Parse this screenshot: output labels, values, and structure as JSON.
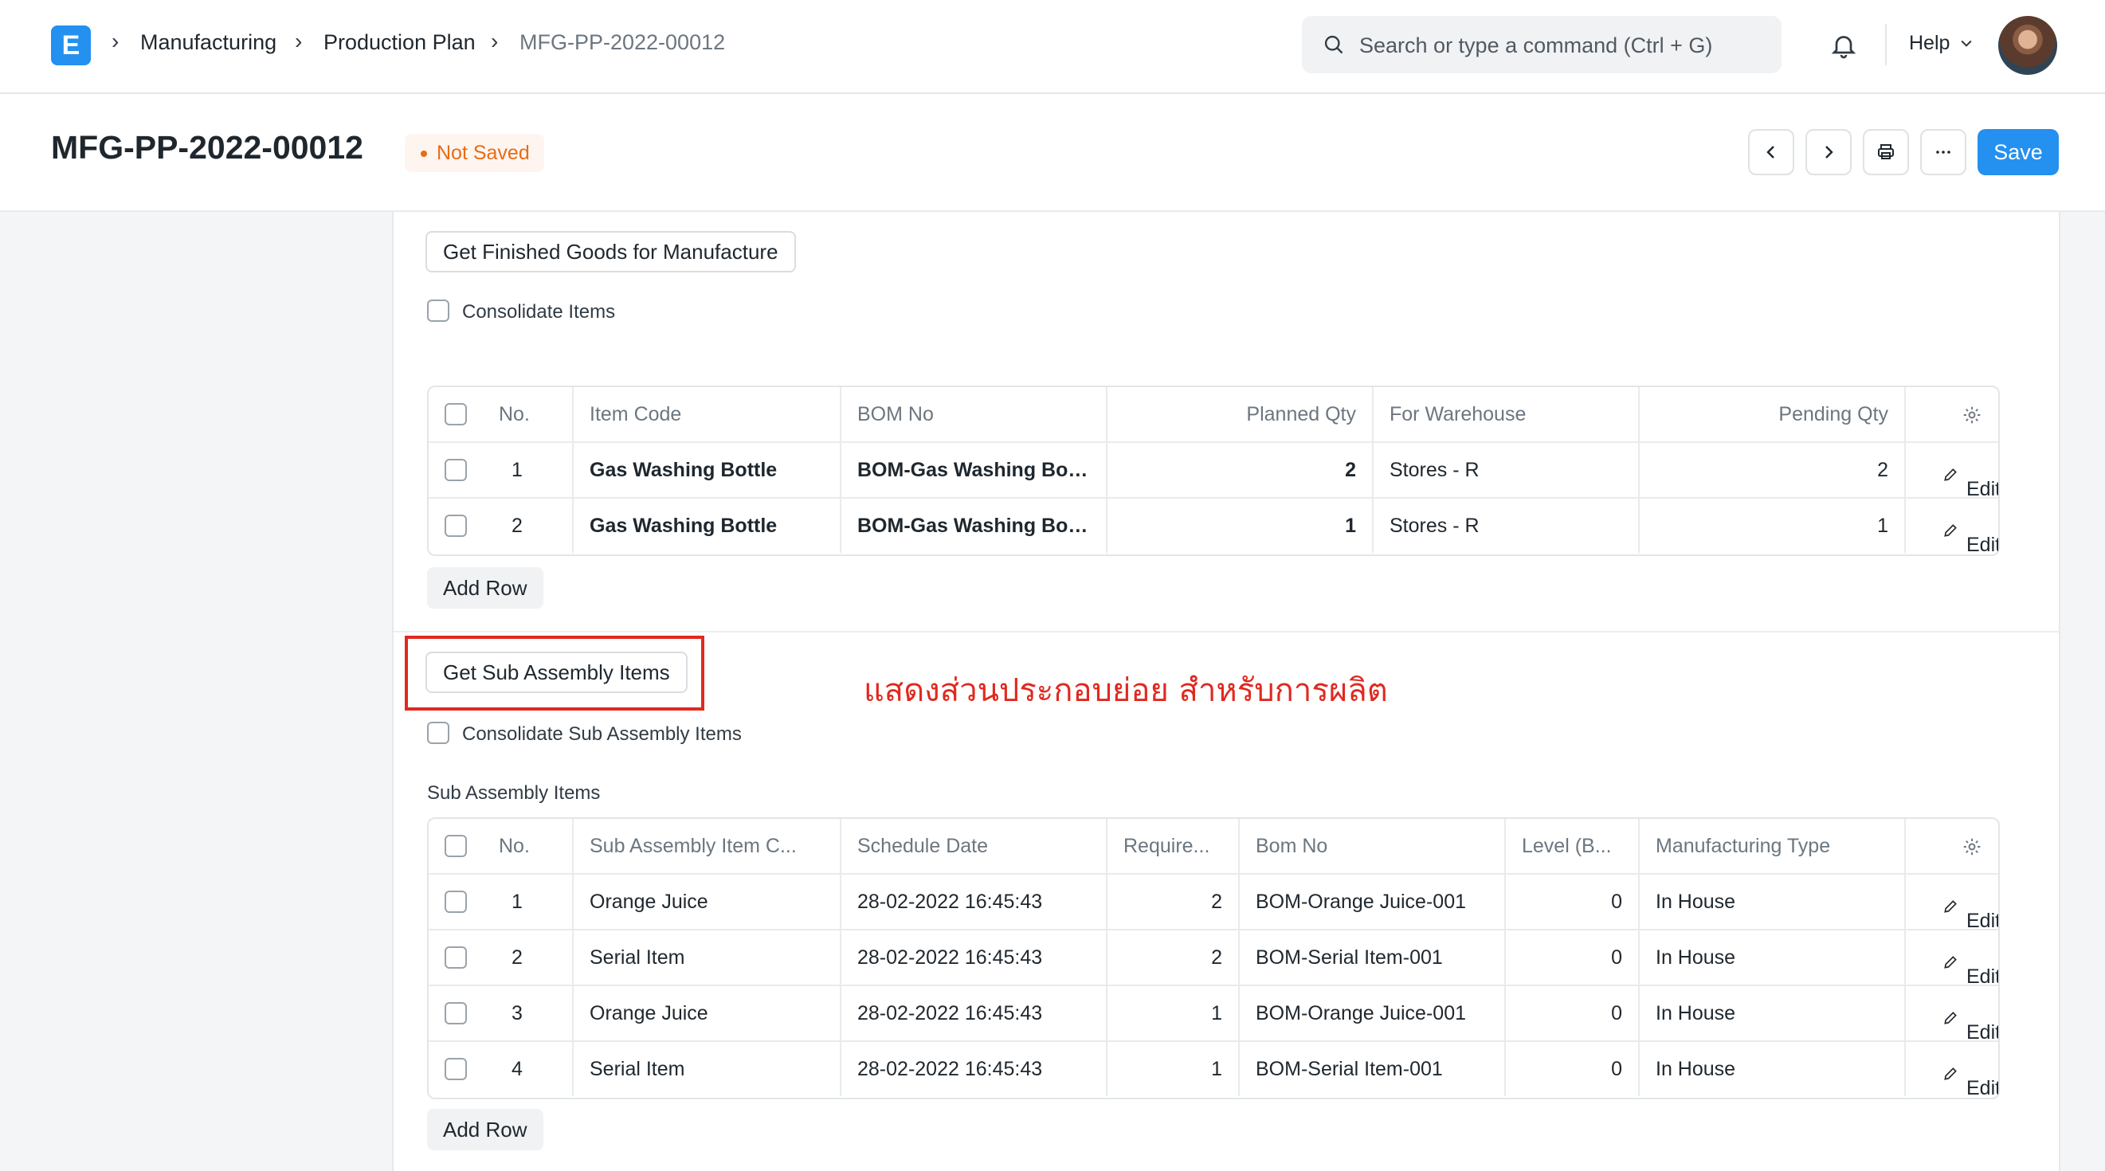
{
  "navbar": {
    "logo_letter": "E",
    "breadcrumbs": [
      "Manufacturing",
      "Production Plan",
      "MFG-PP-2022-00012"
    ],
    "search_placeholder": "Search or type a command (Ctrl + G)",
    "help_label": "Help"
  },
  "page": {
    "title": "MFG-PP-2022-00012",
    "status": "Not Saved",
    "save_label": "Save"
  },
  "finished_goods": {
    "get_button": "Get Finished Goods for Manufacture",
    "consolidate_label": "Consolidate Items",
    "columns": [
      "No.",
      "Item Code",
      "BOM No",
      "Planned Qty",
      "For Warehouse",
      "Pending Qty"
    ],
    "rows": [
      {
        "no": "1",
        "item_code": "Gas Washing Bottle",
        "bom_no": "BOM-Gas Washing Bot...",
        "planned_qty": "2",
        "warehouse": "Stores - R",
        "pending_qty": "2",
        "edit": "Edit"
      },
      {
        "no": "2",
        "item_code": "Gas Washing Bottle",
        "bom_no": "BOM-Gas Washing Bot...",
        "planned_qty": "1",
        "warehouse": "Stores - R",
        "pending_qty": "1",
        "edit": "Edit"
      }
    ],
    "add_row": "Add Row"
  },
  "sub_assembly": {
    "get_button": "Get Sub Assembly Items",
    "annotation": "แสดงส่วนประกอบย่อย สำหรับการผลิต",
    "consolidate_label": "Consolidate Sub Assembly Items",
    "caption": "Sub Assembly Items",
    "columns": [
      "No.",
      "Sub Assembly Item C...",
      "Schedule Date",
      "Require...",
      "Bom No",
      "Level (B...",
      "Manufacturing Type"
    ],
    "rows": [
      {
        "no": "1",
        "item": "Orange Juice",
        "date": "28-02-2022 16:45:43",
        "required": "2",
        "bom": "BOM-Orange Juice-001",
        "level": "0",
        "type": "In House",
        "edit": "Edit"
      },
      {
        "no": "2",
        "item": "Serial Item",
        "date": "28-02-2022 16:45:43",
        "required": "2",
        "bom": "BOM-Serial Item-001",
        "level": "0",
        "type": "In House",
        "edit": "Edit"
      },
      {
        "no": "3",
        "item": "Orange Juice",
        "date": "28-02-2022 16:45:43",
        "required": "1",
        "bom": "BOM-Orange Juice-001",
        "level": "0",
        "type": "In House",
        "edit": "Edit"
      },
      {
        "no": "4",
        "item": "Serial Item",
        "date": "28-02-2022 16:45:43",
        "required": "1",
        "bom": "BOM-Serial Item-001",
        "level": "0",
        "type": "In House",
        "edit": "Edit"
      }
    ],
    "add_row": "Add Row"
  },
  "colors": {
    "primary": "#2490ef",
    "status_orange": "#e86c13",
    "annotation_red": "#e0291f"
  },
  "icons": [
    "app-logo-icon",
    "chevron-right-icon",
    "search-icon",
    "bell-icon",
    "chevron-down-icon",
    "chevron-left-icon",
    "printer-icon",
    "more-icon",
    "pencil-icon",
    "gear-icon"
  ]
}
